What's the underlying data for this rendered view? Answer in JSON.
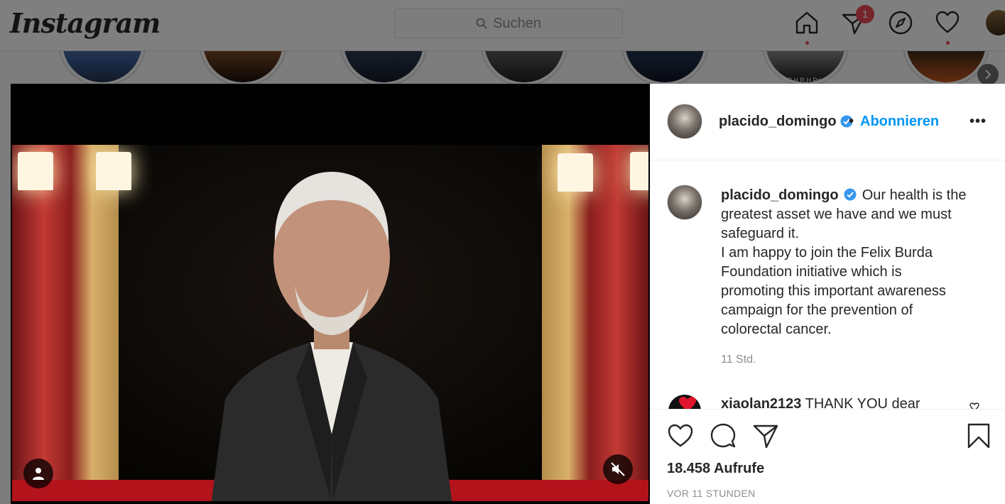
{
  "header": {
    "logo": "Instagram",
    "search_placeholder": "Suchen",
    "notification_count": "1"
  },
  "post": {
    "username": "placido_domingo",
    "follow_label": "Abonnieren",
    "separator": "•",
    "more_label": "•••",
    "caption_lines": [
      "Our health is the",
      "greatest asset we have and we must",
      "safeguard it.",
      "I am happy to join the Felix Burda",
      "Foundation initiative which is",
      "promoting this important awareness",
      "campaign for the prevention of",
      "colorectal cancer."
    ],
    "time_ago": "11 Std.",
    "comment_user": "xiaolan2123",
    "comment_text": "THANK YOU dear",
    "views": "18.458 Aufrufe",
    "timestamp": "VOR 11 STUNDEN"
  },
  "stories": {
    "story_label": "RIP H.R.H Prince"
  },
  "colors": {
    "accent_blue": "#0095f6",
    "notification_red": "#ed4956"
  }
}
